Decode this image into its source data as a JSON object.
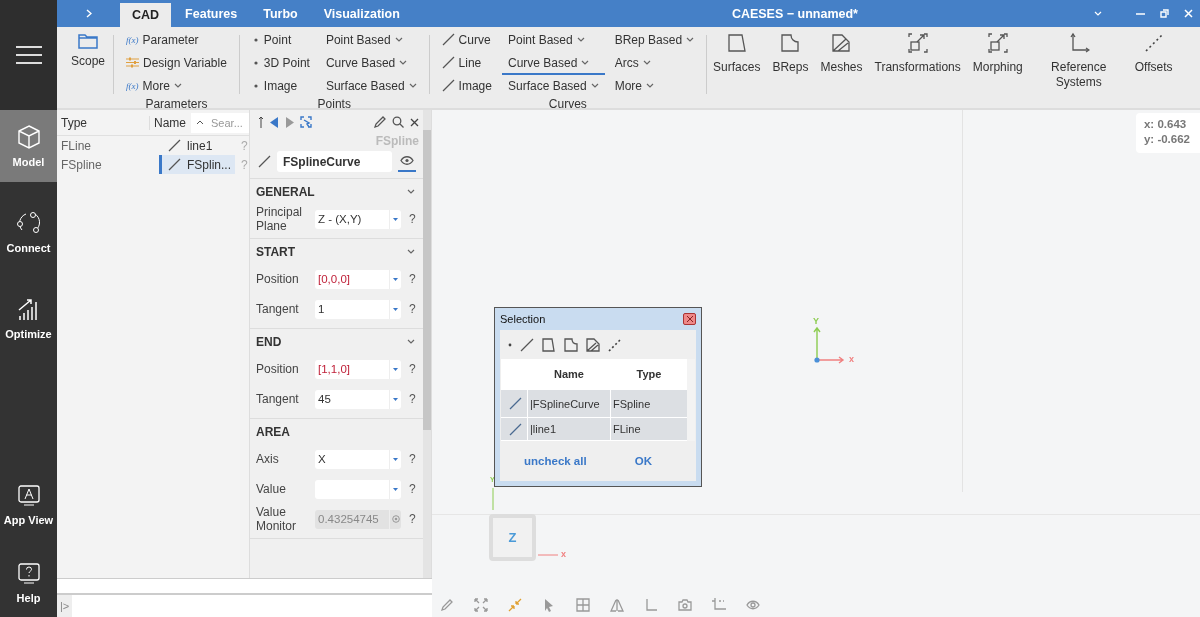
{
  "sidebar": {
    "top_items": [
      {
        "label": "Model",
        "selected": true
      },
      {
        "label": "Connect",
        "selected": false
      },
      {
        "label": "Optimize",
        "selected": false
      }
    ],
    "bottom_items": [
      {
        "label": "App View",
        "selected": false
      },
      {
        "label": "Help",
        "selected": false
      }
    ]
  },
  "title_bar": {
    "tabs": [
      {
        "label": "CAD",
        "selected": true
      },
      {
        "label": "Features",
        "selected": false
      },
      {
        "label": "Turbo",
        "selected": false
      },
      {
        "label": "Visualization",
        "selected": false
      }
    ],
    "title": "CAESES − unnamed*"
  },
  "ribbon": {
    "scope": {
      "label": "Scope"
    },
    "groups": [
      {
        "label": "Parameters",
        "columns": [
          [
            {
              "label": "Parameter",
              "kind": "function",
              "symbol": "f(x)",
              "dropdown": false,
              "selected": false
            },
            {
              "label": "Design Variable",
              "kind": "variable",
              "dropdown": false,
              "selected": false
            },
            {
              "label": "More",
              "kind": "function",
              "symbol": "f(x)",
              "dropdown": true,
              "selected": false
            }
          ]
        ]
      },
      {
        "label": "Points",
        "columns": [
          [
            {
              "label": "Point",
              "kind": "point",
              "dropdown": false,
              "selected": false
            },
            {
              "label": "3D Point",
              "kind": "point",
              "dropdown": false,
              "selected": false
            },
            {
              "label": "Image",
              "kind": "point",
              "dropdown": false,
              "selected": false
            }
          ],
          [
            {
              "label": "Point Based",
              "kind": "menu",
              "dropdown": true,
              "selected": false
            },
            {
              "label": "Curve Based",
              "kind": "menu",
              "dropdown": true,
              "selected": false
            },
            {
              "label": "Surface Based",
              "kind": "menu",
              "dropdown": true,
              "selected": false
            }
          ]
        ]
      },
      {
        "label": "Curves",
        "columns": [
          [
            {
              "label": "Curve",
              "kind": "curve",
              "dropdown": false,
              "selected": false
            },
            {
              "label": "Line",
              "kind": "curve",
              "dropdown": false,
              "selected": false
            },
            {
              "label": "Image",
              "kind": "curve",
              "dropdown": false,
              "selected": false
            }
          ],
          [
            {
              "label": "Point Based",
              "kind": "menu",
              "dropdown": true,
              "selected": false
            },
            {
              "label": "Curve Based",
              "kind": "menu",
              "dropdown": true,
              "selected": true
            },
            {
              "label": "Surface Based",
              "kind": "menu",
              "dropdown": true,
              "selected": false
            }
          ],
          [
            {
              "label": "BRep Based",
              "kind": "menu",
              "dropdown": true,
              "selected": false
            },
            {
              "label": "Arcs",
              "kind": "menu",
              "dropdown": true,
              "selected": false
            },
            {
              "label": "More",
              "kind": "menu",
              "dropdown": true,
              "selected": false
            }
          ]
        ]
      }
    ],
    "large_buttons": [
      "Surfaces",
      "BReps",
      "Meshes",
      "Transformations",
      "Morphing",
      "Reference Systems",
      "Offsets"
    ]
  },
  "tree": {
    "columns": [
      "Type",
      "Name"
    ],
    "search": {
      "placeholder": "Sear..."
    },
    "rows": [
      {
        "type": "FLine",
        "name": "line1",
        "help": "?",
        "selected": false
      },
      {
        "type": "FSpline",
        "name": "FSplin...",
        "help": "?",
        "selected": true
      }
    ]
  },
  "properties": {
    "object_type": "FSpline",
    "name": "FSplineCurve",
    "sections": [
      {
        "title": "GENERAL",
        "collapsible": true,
        "fields": [
          {
            "label": "Principal Plane",
            "value": "Z - (X,Y)",
            "kind": "dropdown",
            "help": "?"
          }
        ]
      },
      {
        "title": "START",
        "collapsible": true,
        "fields": [
          {
            "label": "Position",
            "value": "[0,0,0]",
            "kind": "vector",
            "help": "?"
          },
          {
            "label": "Tangent",
            "value": "1",
            "kind": "dropdown",
            "help": "?"
          }
        ]
      },
      {
        "title": "END",
        "collapsible": true,
        "fields": [
          {
            "label": "Position",
            "value": "[1,1,0]",
            "kind": "vector",
            "help": "?"
          },
          {
            "label": "Tangent",
            "value": "45",
            "kind": "dropdown",
            "help": "?"
          }
        ]
      },
      {
        "title": "AREA",
        "collapsible": false,
        "fields": [
          {
            "label": "Axis",
            "value": "X",
            "kind": "dropdown",
            "help": "?"
          },
          {
            "label": "Value",
            "kind": "dropdown",
            "help": "?"
          },
          {
            "label": "Value Monitor",
            "value": "0.43254745",
            "kind": "monitor",
            "help": "?"
          }
        ]
      }
    ]
  },
  "console": {
    "prompt": "|>"
  },
  "viewport": {
    "coordinates": [
      "x: 0.643",
      "y: -0.662"
    ],
    "triad": {
      "y_label": "Y",
      "x_label": "x"
    },
    "view_cube": {
      "face": "Z",
      "y_label": "Y",
      "x_label": "x"
    },
    "selection_dialog": {
      "title": "Selection",
      "columns": [
        "Name",
        "Type"
      ],
      "rows": [
        {
          "name": "|FSplineCurve",
          "type": "FSpline"
        },
        {
          "name": "|line1",
          "type": "FLine"
        }
      ],
      "buttons": [
        "uncheck all",
        "OK"
      ]
    }
  }
}
